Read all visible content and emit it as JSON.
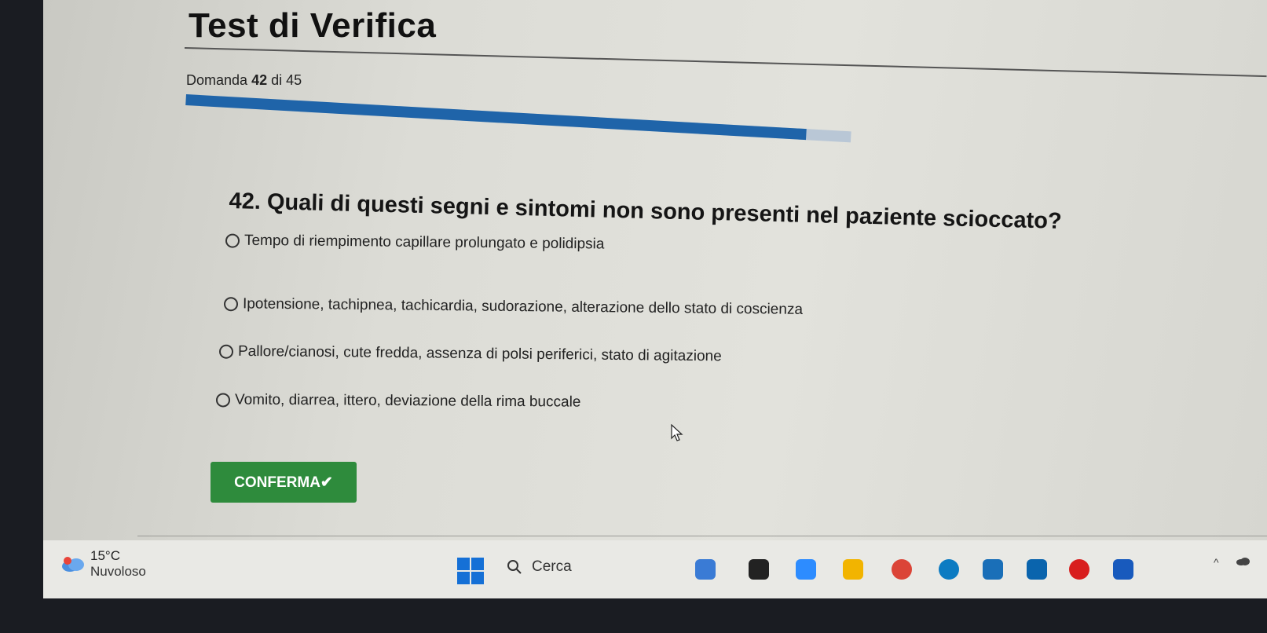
{
  "quiz": {
    "title": "Test di Verifica",
    "counter": {
      "prefix": "Domanda",
      "current": "42",
      "middle": "di",
      "total": "45"
    },
    "progress": 0.9333,
    "question": "42. Quali di questi segni e sintomi non sono presenti nel paziente scioccato?",
    "options": [
      {
        "label": "Tempo di riempimento capillare prolungato e polidipsia"
      },
      {
        "label": "Ipotensione, tachipnea, tachicardia, sudorazione, alterazione dello stato di coscienza"
      },
      {
        "label": "Pallore/cianosi, cute fredda, assenza di polsi periferici, stato di agitazione"
      },
      {
        "label": "Vomito, diarrea, ittero, deviazione della rima buccale"
      }
    ],
    "confirm_label": "CONFERMA✔"
  },
  "taskbar": {
    "weather": {
      "temp": "15°C",
      "label": "Nuvoloso",
      "icon": "cloud-icon"
    },
    "search_label": "Cerca",
    "apps": [
      {
        "name": "copilot-icon",
        "color": "#3a7bd5"
      },
      {
        "name": "task-view-icon",
        "color": "#222222"
      },
      {
        "name": "zoom-icon",
        "color": "#2d8cff"
      },
      {
        "name": "file-explorer-icon",
        "color": "#f2b400"
      },
      {
        "name": "chrome-icon",
        "color": "#db4437"
      },
      {
        "name": "edge-icon",
        "color": "#0c7bc2"
      },
      {
        "name": "store-icon",
        "color": "#1a6fb8"
      },
      {
        "name": "outlook-icon",
        "color": "#0a64ad"
      },
      {
        "name": "acrobat-icon",
        "color": "#d81e1e"
      },
      {
        "name": "word-icon",
        "color": "#185abd"
      }
    ]
  }
}
